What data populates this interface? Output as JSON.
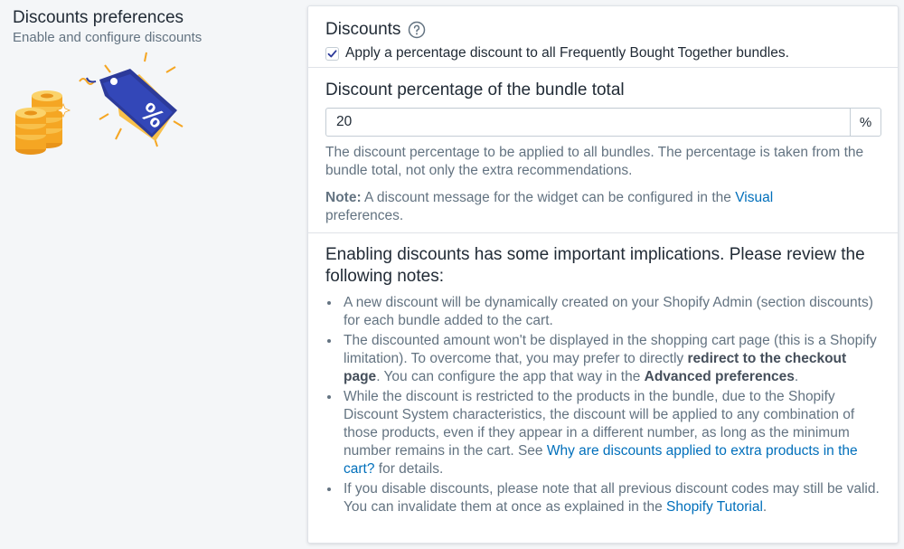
{
  "sidebar": {
    "title": "Discounts preferences",
    "subtitle": "Enable and configure discounts",
    "illustration": "coins-and-discount-tag-icon"
  },
  "discounts": {
    "heading": "Discounts",
    "help_icon": "question-circle-icon",
    "checkbox_checked": true,
    "checkbox_label": "Apply a percentage discount to all Frequently Bought Together bundles."
  },
  "percentage": {
    "heading": "Discount percentage of the bundle total",
    "value": "20",
    "suffix": "%",
    "help": "The discount percentage to be applied to all bundles. The percentage is taken from the bundle total, not only the extra recommendations.",
    "note_label": "Note:",
    "note_text": " A discount message for the widget can be configured in the ",
    "note_link": "Visual",
    "note_tail": " preferences."
  },
  "implications": {
    "heading": "Enabling discounts has some important implications. Please review the following notes:",
    "item1": "A new discount will be dynamically created on your Shopify Admin (section discounts) for each bundle added to the cart.",
    "item2_a": "The discounted amount won't be displayed in the shopping cart page (this is a Shopify limitation). To overcome that, you may prefer to directly ",
    "item2_b": "redirect to the checkout page",
    "item2_c": ". You can configure the app that way in the ",
    "item2_d": "Advanced preferences",
    "item2_e": ".",
    "item3_a": "While the discount is restricted to the products in the bundle, due to the Shopify Discount System characteristics, the discount will be applied to any combination of those products, even if they appear in a different number, as long as the minimum number remains in the cart. See ",
    "item3_link": "Why are discounts applied to extra products in the cart?",
    "item3_c": " for details.",
    "item4_a": "If you disable discounts, please note that all previous discount codes may still be valid. You can invalidate them at once as explained in the ",
    "item4_link": "Shopify Tutorial",
    "item4_c": "."
  },
  "colors": {
    "link": "#006fbb",
    "text": "#212b36",
    "subdued": "#637381",
    "tag": "#2c3a9a",
    "coin": "#f5a623"
  }
}
